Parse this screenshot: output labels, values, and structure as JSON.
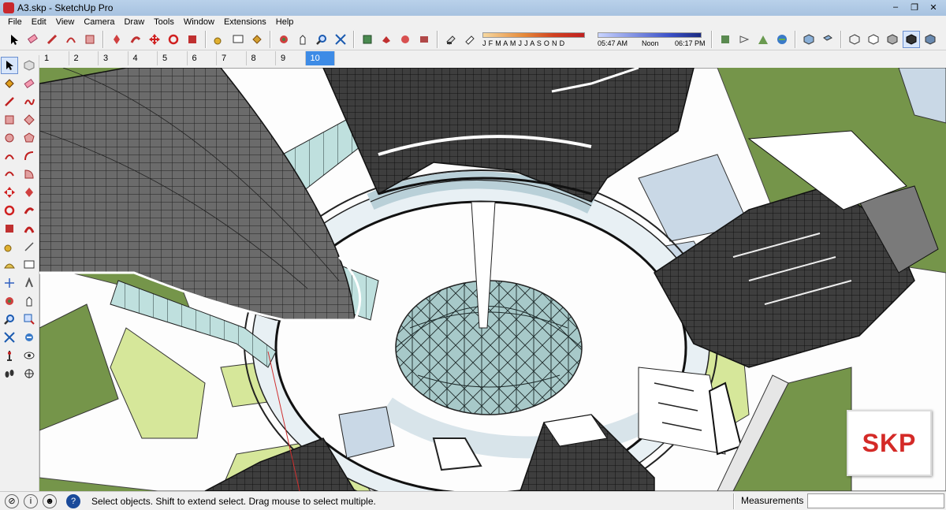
{
  "window": {
    "title": "A3.skp - SketchUp Pro",
    "minimize": "–",
    "restore": "❐",
    "close": "✕"
  },
  "menu": [
    "File",
    "Edit",
    "View",
    "Camera",
    "Draw",
    "Tools",
    "Window",
    "Extensions",
    "Help"
  ],
  "shadows": {
    "months": "J F M A M J J A S O N D",
    "time_start": "05:47 AM",
    "time_noon": "Noon",
    "time_end": "06:17 PM"
  },
  "scene_tabs": [
    "1",
    "2",
    "3",
    "4",
    "5",
    "6",
    "7",
    "8",
    "9",
    "10"
  ],
  "active_scene": "10",
  "status": {
    "hint": "Select objects. Shift to extend select. Drag mouse to select multiple.",
    "measurements_label": "Measurements",
    "measurements_value": "",
    "info_icon": "?"
  },
  "logo_text": "SKP",
  "colors": {
    "accent_tab": "#3d8be6",
    "logo_red": "#d42a27",
    "grass": "#7a9a4c"
  }
}
